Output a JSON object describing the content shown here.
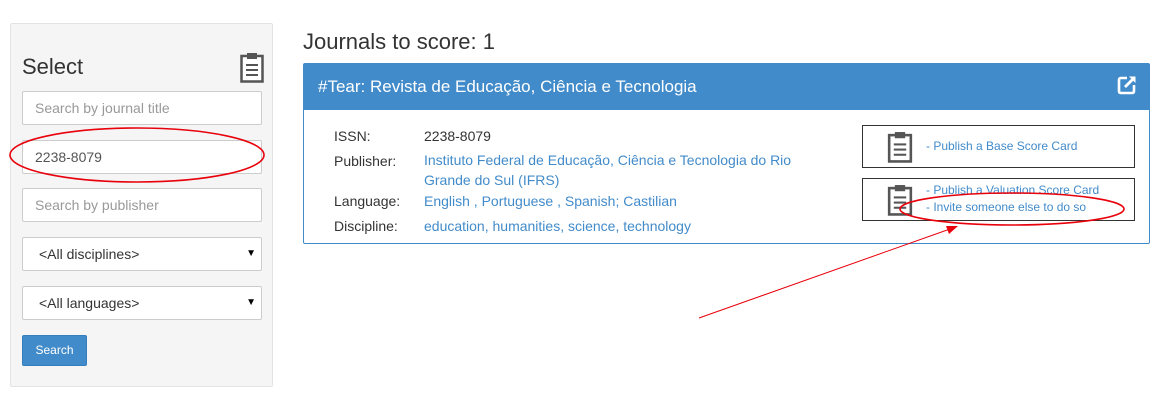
{
  "sidebar": {
    "title": "Select",
    "journal_title_placeholder": "Search by journal title",
    "issn_value": "2238-8079",
    "publisher_placeholder": "Search by publisher",
    "disciplines_selected": "<All disciplines>",
    "languages_selected": "<All languages>",
    "search_label": "Search"
  },
  "main": {
    "heading": "Journals to score: 1",
    "journal": {
      "title": "#Tear: Revista de Educação, Ciência e Tecnologia",
      "issn_label": "ISSN:",
      "issn": "2238-8079",
      "publisher_label": "Publisher:",
      "publisher": "Instituto Federal de Educação, Ciência e Tecnologia do Rio Grande do Sul (IFRS)",
      "language_label": "Language:",
      "language": "English , Portuguese , Spanish; Castilian",
      "discipline_label": "Discipline:",
      "discipline": "education, humanities, science, technology"
    },
    "actions": {
      "base_card": "- Publish a Base Score Card",
      "valuation_card": "- Publish a Valuation Score Card",
      "invite": "- Invite someone else to do so"
    }
  },
  "colors": {
    "accent": "#428bca",
    "annotation": "#e8000b"
  },
  "icons": [
    "clipboard-icon",
    "external-link-icon"
  ]
}
